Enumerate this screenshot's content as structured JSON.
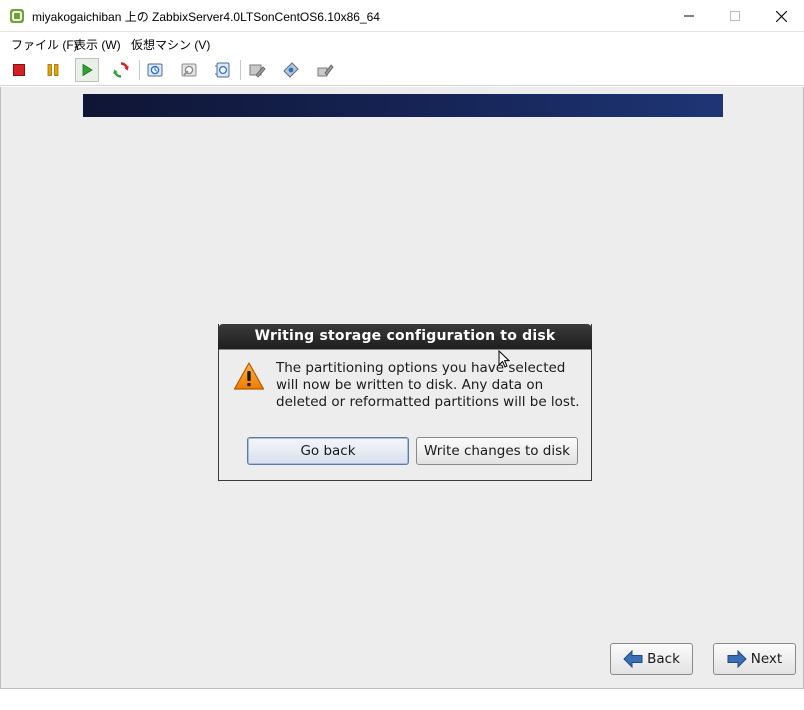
{
  "window": {
    "title": "miyakogaichiban 上の ZabbixServer4.0LTSonCentOS6.10x86_64"
  },
  "menu": {
    "items": [
      {
        "label": "ファイル (F)"
      },
      {
        "label": "表示 (W)"
      },
      {
        "label": "仮想マシン (V)"
      }
    ]
  },
  "toolbar": {
    "icons": [
      "stop-icon",
      "pause-icon",
      "play-icon",
      "reset-icon",
      "snapshot-take-icon",
      "snapshot-revert-icon",
      "snapshot-manager-icon",
      "edit-settings-icon",
      "cd-dvd-icon",
      "network-icon"
    ]
  },
  "dialog": {
    "title": "Writing storage configuration to disk",
    "message": "The partitioning options you have selected\nwill now be written to disk.  Any data on\ndeleted or reformatted partitions will be lost.",
    "go_back_label": "Go back",
    "write_label": "Write changes to disk"
  },
  "nav": {
    "back_label": "Back",
    "next_label": "Next"
  },
  "colors": {
    "banner": "#162456",
    "dialog_title_bg": "#2b2b2b",
    "vm_background": "#ededed",
    "arrow_blue": "#3a6fb5"
  }
}
